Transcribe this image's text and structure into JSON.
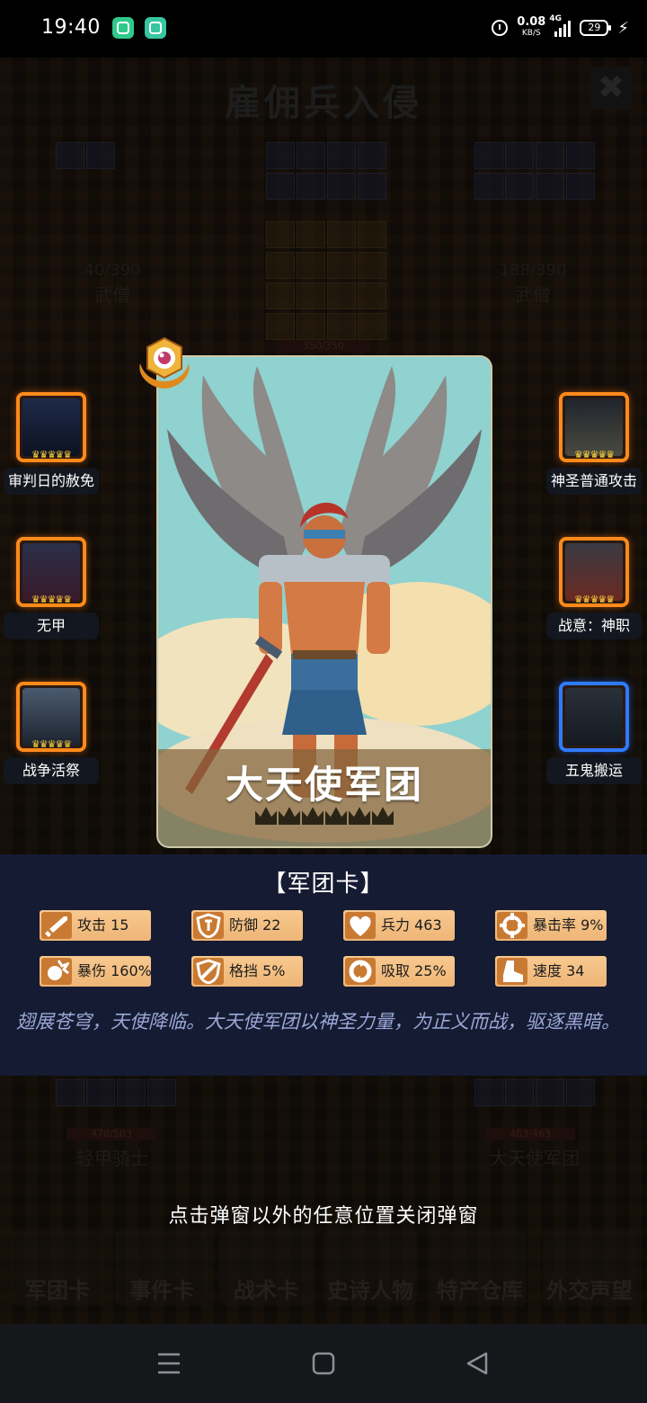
{
  "status_bar": {
    "time": "19:40",
    "net_speed": "0.08",
    "net_unit": "KB/S",
    "network": "4G",
    "battery": "29",
    "icons": [
      "phone-app-icon",
      "chat-app-icon",
      "alarm-icon",
      "signal-icon",
      "battery-icon",
      "charging-icon"
    ]
  },
  "background": {
    "title": "雇佣兵入侵",
    "left_top_count": "40/390",
    "left_top_name": "武僧",
    "right_top_count": "188/390",
    "right_top_name": "武僧",
    "center_bar": "350/350",
    "left_bottom_bar": "478/503",
    "left_bottom_name": "轻甲骑士",
    "right_bottom_bar": "463/463",
    "right_bottom_name": "大天使军团"
  },
  "skills_left": [
    {
      "label": "审判日的赦免",
      "frame": "orange"
    },
    {
      "label": "无甲",
      "frame": "orange"
    },
    {
      "label": "战争活祭",
      "frame": "orange"
    }
  ],
  "skills_right": [
    {
      "label": "神圣普通攻击",
      "frame": "orange"
    },
    {
      "label": "战意：神职",
      "frame": "orange"
    },
    {
      "label": "五鬼搬运",
      "frame": "blue"
    }
  ],
  "card": {
    "name": "大天使军团",
    "stars": 6
  },
  "panel": {
    "title": "【军团卡】",
    "stats": [
      {
        "label": "攻击",
        "value": "15",
        "icon": "sword-icon"
      },
      {
        "label": "防御",
        "value": "22",
        "icon": "shield-icon"
      },
      {
        "label": "兵力",
        "value": "463",
        "icon": "heart-icon"
      },
      {
        "label": "暴击率",
        "value": "9%",
        "icon": "crit-icon"
      },
      {
        "label": "暴伤",
        "value": "160%",
        "icon": "burst-icon"
      },
      {
        "label": "格挡",
        "value": "5%",
        "icon": "block-icon"
      },
      {
        "label": "吸取",
        "value": "25%",
        "icon": "drain-icon"
      },
      {
        "label": "速度",
        "value": "34",
        "icon": "boot-icon"
      }
    ],
    "description": "翅展苍穹，天使降临。大天使军团以神圣力量，为正义而战，驱逐黑暗。"
  },
  "close_hint": "点击弹窗以外的任意位置关闭弹窗",
  "bottom_nav": [
    "军团卡",
    "事件卡",
    "战术卡",
    "史诗人物",
    "特产仓库",
    "外交声望"
  ],
  "colors": {
    "panel_bg": "#161c34",
    "stat_bg": "#f6c38a",
    "frame_orange": "#ff8a1a",
    "frame_blue": "#2f7bff",
    "desc_text": "#9aa8d6"
  }
}
